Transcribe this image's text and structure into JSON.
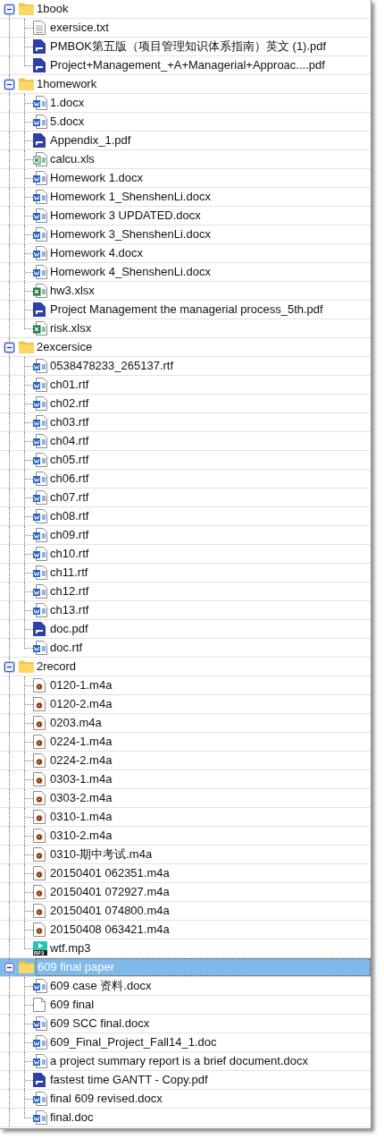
{
  "tree": [
    {
      "name": "1book",
      "expanded": true,
      "selected": false,
      "children": [
        {
          "name": "exersice.txt",
          "kind": "text",
          "selected": false
        },
        {
          "name": "PMBOK第五版（项目管理知识体系指南）英文 (1).pdf",
          "kind": "pdf",
          "selected": false
        },
        {
          "name": "Project+Management_+A+Managerial+Approac....pdf",
          "kind": "pdf",
          "selected": false
        }
      ]
    },
    {
      "name": "1homework",
      "expanded": true,
      "selected": false,
      "children": [
        {
          "name": "1.docx",
          "kind": "word",
          "selected": false
        },
        {
          "name": "5.docx",
          "kind": "word",
          "selected": false
        },
        {
          "name": "Appendix_1.pdf",
          "kind": "pdf",
          "selected": false
        },
        {
          "name": "calcu.xls",
          "kind": "excel-old",
          "selected": false
        },
        {
          "name": "Homework 1.docx",
          "kind": "word",
          "selected": false
        },
        {
          "name": "Homework 1_ShenshenLi.docx",
          "kind": "word",
          "selected": false
        },
        {
          "name": "Homework 3 UPDATED.docx",
          "kind": "word",
          "selected": false
        },
        {
          "name": "Homework 3_ShenshenLi.docx",
          "kind": "word",
          "selected": false
        },
        {
          "name": "Homework 4.docx",
          "kind": "word",
          "selected": false
        },
        {
          "name": "Homework 4_ShenshenLi.docx",
          "kind": "word",
          "selected": false
        },
        {
          "name": "hw3.xlsx",
          "kind": "excel",
          "selected": false
        },
        {
          "name": "Project Management the managerial process_5th.pdf",
          "kind": "pdf",
          "selected": false
        },
        {
          "name": "risk.xlsx",
          "kind": "excel",
          "selected": false
        }
      ]
    },
    {
      "name": "2excersice",
      "expanded": true,
      "selected": false,
      "children": [
        {
          "name": "0538478233_265137.rtf",
          "kind": "word",
          "selected": false
        },
        {
          "name": "ch01.rtf",
          "kind": "word",
          "selected": false
        },
        {
          "name": "ch02.rtf",
          "kind": "word",
          "selected": false
        },
        {
          "name": "ch03.rtf",
          "kind": "word",
          "selected": false
        },
        {
          "name": "ch04.rtf",
          "kind": "word",
          "selected": false
        },
        {
          "name": "ch05.rtf",
          "kind": "word",
          "selected": false
        },
        {
          "name": "ch06.rtf",
          "kind": "word",
          "selected": false
        },
        {
          "name": "ch07.rtf",
          "kind": "word",
          "selected": false
        },
        {
          "name": "ch08.rtf",
          "kind": "word",
          "selected": false
        },
        {
          "name": "ch09.rtf",
          "kind": "word",
          "selected": false
        },
        {
          "name": "ch10.rtf",
          "kind": "word",
          "selected": false
        },
        {
          "name": "ch11.rtf",
          "kind": "word",
          "selected": false
        },
        {
          "name": "ch12.rtf",
          "kind": "word",
          "selected": false
        },
        {
          "name": "ch13.rtf",
          "kind": "word",
          "selected": false
        },
        {
          "name": "doc.pdf",
          "kind": "pdf",
          "selected": false
        },
        {
          "name": "doc.rtf",
          "kind": "word",
          "selected": false
        }
      ]
    },
    {
      "name": "2record",
      "expanded": true,
      "selected": false,
      "children": [
        {
          "name": "0120-1.m4a",
          "kind": "audio",
          "selected": false
        },
        {
          "name": "0120-2.m4a",
          "kind": "audio",
          "selected": false
        },
        {
          "name": "0203.m4a",
          "kind": "audio",
          "selected": false
        },
        {
          "name": "0224-1.m4a",
          "kind": "audio",
          "selected": false
        },
        {
          "name": "0224-2.m4a",
          "kind": "audio",
          "selected": false
        },
        {
          "name": "0303-1.m4a",
          "kind": "audio",
          "selected": false
        },
        {
          "name": "0303-2.m4a",
          "kind": "audio",
          "selected": false
        },
        {
          "name": "0310-1.m4a",
          "kind": "audio",
          "selected": false
        },
        {
          "name": "0310-2.m4a",
          "kind": "audio",
          "selected": false
        },
        {
          "name": "0310-期中考试.m4a",
          "kind": "audio",
          "selected": false
        },
        {
          "name": "20150401 062351.m4a",
          "kind": "audio",
          "selected": false
        },
        {
          "name": "20150401 072927.m4a",
          "kind": "audio",
          "selected": false
        },
        {
          "name": "20150401 074800.m4a",
          "kind": "audio",
          "selected": false
        },
        {
          "name": "20150408 063421.m4a",
          "kind": "audio",
          "selected": false
        },
        {
          "name": "wtf.mp3",
          "kind": "mp3",
          "selected": false
        }
      ]
    },
    {
      "name": "609 final paper",
      "expanded": true,
      "selected": true,
      "children": [
        {
          "name": "609 case 资料.docx",
          "kind": "word",
          "selected": false
        },
        {
          "name": "609 final",
          "kind": "blank",
          "selected": false
        },
        {
          "name": "609 SCC final.docx",
          "kind": "word",
          "selected": false
        },
        {
          "name": "609_Final_Project_Fall14_1.doc",
          "kind": "word",
          "selected": false
        },
        {
          "name": "a project summary report is a brief document.docx",
          "kind": "word",
          "selected": false
        },
        {
          "name": "fastest time GANTT - Copy.pdf",
          "kind": "pdf",
          "selected": false
        },
        {
          "name": "final 609 revised.docx",
          "kind": "word",
          "selected": false
        },
        {
          "name": "final.doc",
          "kind": "word",
          "selected": false
        }
      ]
    }
  ]
}
